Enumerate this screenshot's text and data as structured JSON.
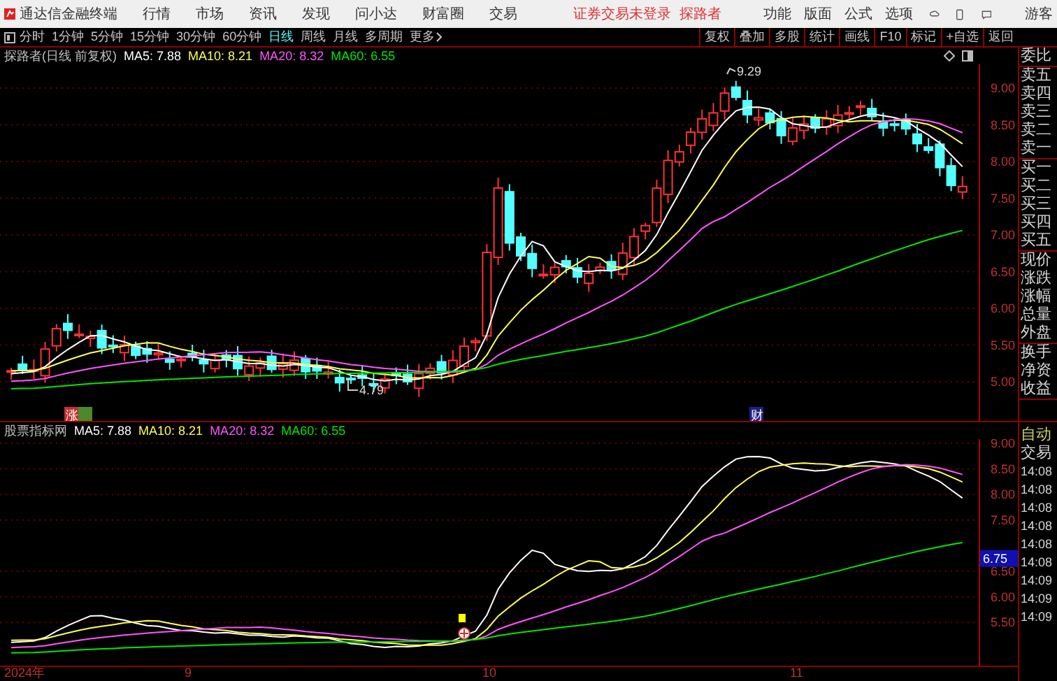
{
  "app": {
    "title": "通达信金融终端",
    "menu": [
      "行情",
      "市场",
      "资讯",
      "发现",
      "问小达",
      "财富圈",
      "交易"
    ],
    "notice": "证券交易未登录",
    "user_label": "探路者",
    "menu_right": [
      "功能",
      "版面",
      "公式",
      "选项"
    ],
    "guest": "游客"
  },
  "periods": [
    {
      "label": "分时",
      "selected": false
    },
    {
      "label": "1分钟",
      "selected": false
    },
    {
      "label": "5分钟",
      "selected": false
    },
    {
      "label": "15分钟",
      "selected": false
    },
    {
      "label": "30分钟",
      "selected": false
    },
    {
      "label": "60分钟",
      "selected": false
    },
    {
      "label": "日线",
      "selected": true
    },
    {
      "label": "周线",
      "selected": false
    },
    {
      "label": "月线",
      "selected": false
    },
    {
      "label": "多周期",
      "selected": false
    },
    {
      "label": "更多",
      "selected": false
    }
  ],
  "tools": [
    "复权",
    "叠加",
    "多股",
    "统计",
    "画线",
    "F10",
    "标记",
    "+自选",
    "返回"
  ],
  "main_chart": {
    "title": "探路者(日线 前复权)",
    "legend": [
      {
        "text": "MA5: 7.88",
        "color": "#ffffff"
      },
      {
        "text": "MA10: 8.21",
        "color": "#ffff54"
      },
      {
        "text": "MA20: 8.32",
        "color": "#ff54ff"
      },
      {
        "text": "MA60: 6.55",
        "color": "#00e600"
      }
    ],
    "high_label": "9.29",
    "low_label": "4.79",
    "yticks": [
      "9.00",
      "8.50",
      "8.00",
      "7.50",
      "7.00",
      "6.50",
      "6.00",
      "5.50",
      "5.00"
    ],
    "badges": [
      "涨",
      "财"
    ]
  },
  "indicator": {
    "title": "股票指标网",
    "legend": [
      {
        "text": "MA5: 7.88",
        "color": "#ffffff"
      },
      {
        "text": "MA10: 8.21",
        "color": "#ffff54"
      },
      {
        "text": "MA20: 8.32",
        "color": "#ff54ff"
      },
      {
        "text": "MA60: 6.55",
        "color": "#00e600"
      }
    ],
    "yticks": [
      "9.00",
      "8.50",
      "8.00",
      "7.50",
      "6.50",
      "6.00",
      "5.50"
    ],
    "cursor_value": "6.75"
  },
  "x_axis": [
    "2024年",
    "9",
    "10",
    "11"
  ],
  "quote_panel": {
    "groups": [
      {
        "rows": [
          "委比"
        ]
      },
      {
        "rows": [
          "卖五",
          "卖四",
          "卖三",
          "卖二",
          "卖一"
        ]
      },
      {
        "rows": [
          "买一",
          "买二",
          "买三",
          "买四",
          "买五"
        ]
      },
      {
        "rows": [
          "现价",
          "涨跌",
          "涨幅",
          "总量",
          "外盘"
        ]
      },
      {
        "rows": [
          "换手",
          "净资",
          "收益"
        ]
      }
    ]
  },
  "trade_panel": {
    "mode": "自动",
    "label": "交易",
    "times": [
      "14:08",
      "14:08",
      "14:08",
      "14:08",
      "14:08",
      "14:08",
      "14:09",
      "14:09",
      "14:09"
    ]
  }
}
